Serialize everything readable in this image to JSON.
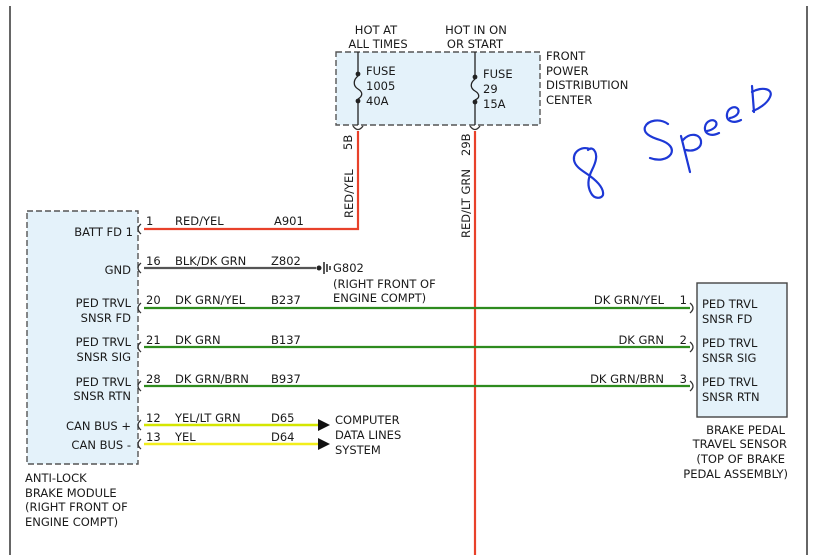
{
  "fpdc": {
    "hot_always_1": "HOT AT",
    "hot_always_2": "ALL TIMES",
    "hot_run_1": "HOT IN ON",
    "hot_run_2": "OR START",
    "name_1": "FRONT",
    "name_2": "POWER",
    "name_3": "DISTRIBUTION",
    "name_4": "CENTER",
    "fuse_a_1": "FUSE",
    "fuse_a_2": "1005",
    "fuse_a_3": "40A",
    "fuse_b_1": "FUSE",
    "fuse_b_2": "29",
    "fuse_b_3": "15A",
    "term_a": "5B",
    "term_b": "29B",
    "wire_a": "RED/YEL",
    "wire_b": "RED/LT GRN"
  },
  "abs": {
    "title_1": "ANTI-LOCK",
    "title_2": "BRAKE MODULE",
    "title_3": "(RIGHT FRONT OF",
    "title_4": "ENGINE COMPT)",
    "pins": [
      {
        "lines": [
          "BATT FD 1"
        ],
        "num": "1",
        "color_name": "RED/YEL",
        "circuit": "A901"
      },
      {
        "lines": [
          "GND"
        ],
        "num": "16",
        "color_name": "BLK/DK GRN",
        "circuit": "Z802"
      },
      {
        "lines": [
          "PED TRVL",
          "SNSR FD"
        ],
        "num": "20",
        "color_name": "DK GRN/YEL",
        "circuit": "B237"
      },
      {
        "lines": [
          "PED TRVL",
          "SNSR SIG"
        ],
        "num": "21",
        "color_name": "DK GRN",
        "circuit": "B137"
      },
      {
        "lines": [
          "PED TRVL",
          "SNSR RTN"
        ],
        "num": "28",
        "color_name": "DK GRN/BRN",
        "circuit": "B937"
      },
      {
        "lines": [
          "CAN BUS +"
        ],
        "num": "12",
        "color_name": "YEL/LT GRN",
        "circuit": "D65"
      },
      {
        "lines": [
          "CAN BUS -"
        ],
        "num": "13",
        "color_name": "YEL",
        "circuit": "D64"
      }
    ]
  },
  "ground": {
    "id": "G802",
    "loc_1": "(RIGHT FRONT OF",
    "loc_2": "ENGINE COMPT)"
  },
  "data_lines": {
    "l1": "COMPUTER",
    "l2": "DATA LINES",
    "l3": "SYSTEM"
  },
  "sensor": {
    "title_1": "BRAKE PEDAL",
    "title_2": "TRAVEL SENSOR",
    "title_3": "(TOP OF BRAKE",
    "title_4": "PEDAL ASSEMBLY)",
    "pins": [
      {
        "lines": [
          "PED TRVL",
          "SNSR FD"
        ],
        "num": "1",
        "color_name": "DK GRN/YEL"
      },
      {
        "lines": [
          "PED TRVL",
          "SNSR SIG"
        ],
        "num": "2",
        "color_name": "DK GRN"
      },
      {
        "lines": [
          "PED TRVL",
          "SNSR RTN"
        ],
        "num": "3",
        "color_name": "DK GRN/BRN"
      }
    ]
  },
  "annotation": {
    "text": "8 Speed",
    "color": "#1d38d6"
  },
  "colors": {
    "red": "#e8412a",
    "green": "#2e8b1e",
    "dark": "#555555",
    "yellow": "#f2ee1a",
    "yellow_green": "#d4e600",
    "box_fill": "#e4f2fa"
  }
}
